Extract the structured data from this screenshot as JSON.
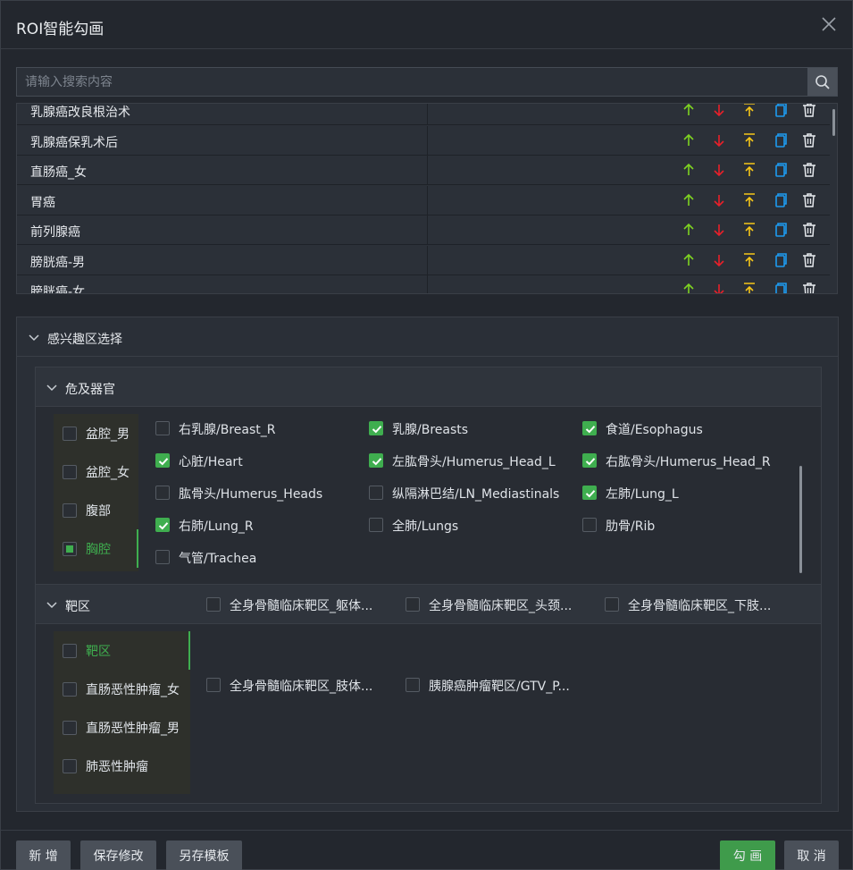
{
  "dialog": {
    "title": "ROI智能勾画"
  },
  "search": {
    "placeholder": "请输入搜索内容"
  },
  "templates": [
    {
      "name": "乳腺癌改良根治术"
    },
    {
      "name": "乳腺癌保乳术后"
    },
    {
      "name": "直肠癌_女"
    },
    {
      "name": "胃癌"
    },
    {
      "name": "前列腺癌"
    },
    {
      "name": "膀胱癌-男"
    },
    {
      "name": "膀胱癌-女"
    }
  ],
  "roi": {
    "section_title": "感兴趣区选择",
    "oar": {
      "title": "危及器官",
      "categories": [
        {
          "label": "盆腔_男",
          "state": "unchecked"
        },
        {
          "label": "盆腔_女",
          "state": "unchecked"
        },
        {
          "label": "腹部",
          "state": "unchecked"
        },
        {
          "label": "胸腔",
          "state": "partial"
        }
      ],
      "options": [
        {
          "label": "右乳腺/Breast_R",
          "checked": false
        },
        {
          "label": "乳腺/Breasts",
          "checked": true
        },
        {
          "label": "食道/Esophagus",
          "checked": true
        },
        {
          "label": "心脏/Heart",
          "checked": true
        },
        {
          "label": "左肱骨头/Humerus_Head_L",
          "checked": true
        },
        {
          "label": "右肱骨头/Humerus_Head_R",
          "checked": true
        },
        {
          "label": "肱骨头/Humerus_Heads",
          "checked": false
        },
        {
          "label": "纵隔淋巴结/LN_Mediastinals",
          "checked": false
        },
        {
          "label": "左肺/Lung_L",
          "checked": true
        },
        {
          "label": "右肺/Lung_R",
          "checked": true
        },
        {
          "label": "全肺/Lungs",
          "checked": false
        },
        {
          "label": "肋骨/Rib",
          "checked": false
        },
        {
          "label": "气管/Trachea",
          "checked": false
        }
      ]
    },
    "target": {
      "title": "靶区",
      "categories": [
        {
          "label": "靶区",
          "state": "unchecked"
        },
        {
          "label": "直肠恶性肿瘤_女",
          "state": "unchecked"
        },
        {
          "label": "直肠恶性肿瘤_男",
          "state": "unchecked"
        },
        {
          "label": "肺恶性肿瘤",
          "state": "unchecked"
        }
      ],
      "options": [
        {
          "label": "全身骨髓临床靶区_躯体...",
          "checked": false
        },
        {
          "label": "全身骨髓临床靶区_头颈...",
          "checked": false
        },
        {
          "label": "全身骨髓临床靶区_下肢...",
          "checked": false
        },
        {
          "label": "全身骨髓临床靶区_肢体...",
          "checked": false
        },
        {
          "label": "胰腺癌肿瘤靶区/GTV_P...",
          "checked": false
        }
      ]
    }
  },
  "footer": {
    "add": "新 增",
    "save": "保存修改",
    "save_as": "另存模板",
    "draw": "勾 画",
    "cancel": "取 消"
  },
  "colors": {
    "up": "#7ed321",
    "down": "#e8202a",
    "top": "#f5c518",
    "copy": "#1e9bf0",
    "accent": "#3fae4f"
  }
}
